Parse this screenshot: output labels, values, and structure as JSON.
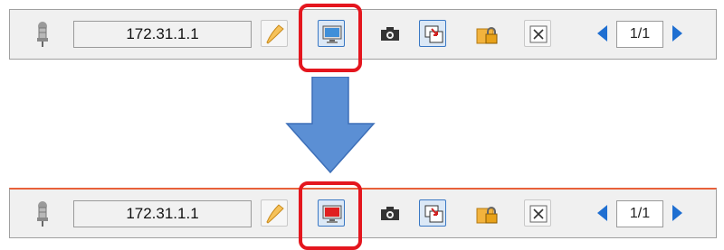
{
  "before": {
    "address": "172.31.1.1",
    "page_indicator": "1/1",
    "screen_color": "#3f8fd9"
  },
  "after": {
    "address": "172.31.1.1",
    "page_indicator": "1/1",
    "screen_color": "#e02020"
  },
  "colors": {
    "highlight": "#e4161e",
    "transition_arrow": "#5b8fd4",
    "nav_arrow": "#1f6fd1",
    "top_rule_after": "#e8613a"
  },
  "icons": [
    "pin-icon",
    "pen-icon",
    "monitor-icon",
    "camera-icon",
    "window-arrow-icon",
    "lock-folder-icon",
    "close-icon",
    "prev-page-icon",
    "next-page-icon"
  ]
}
